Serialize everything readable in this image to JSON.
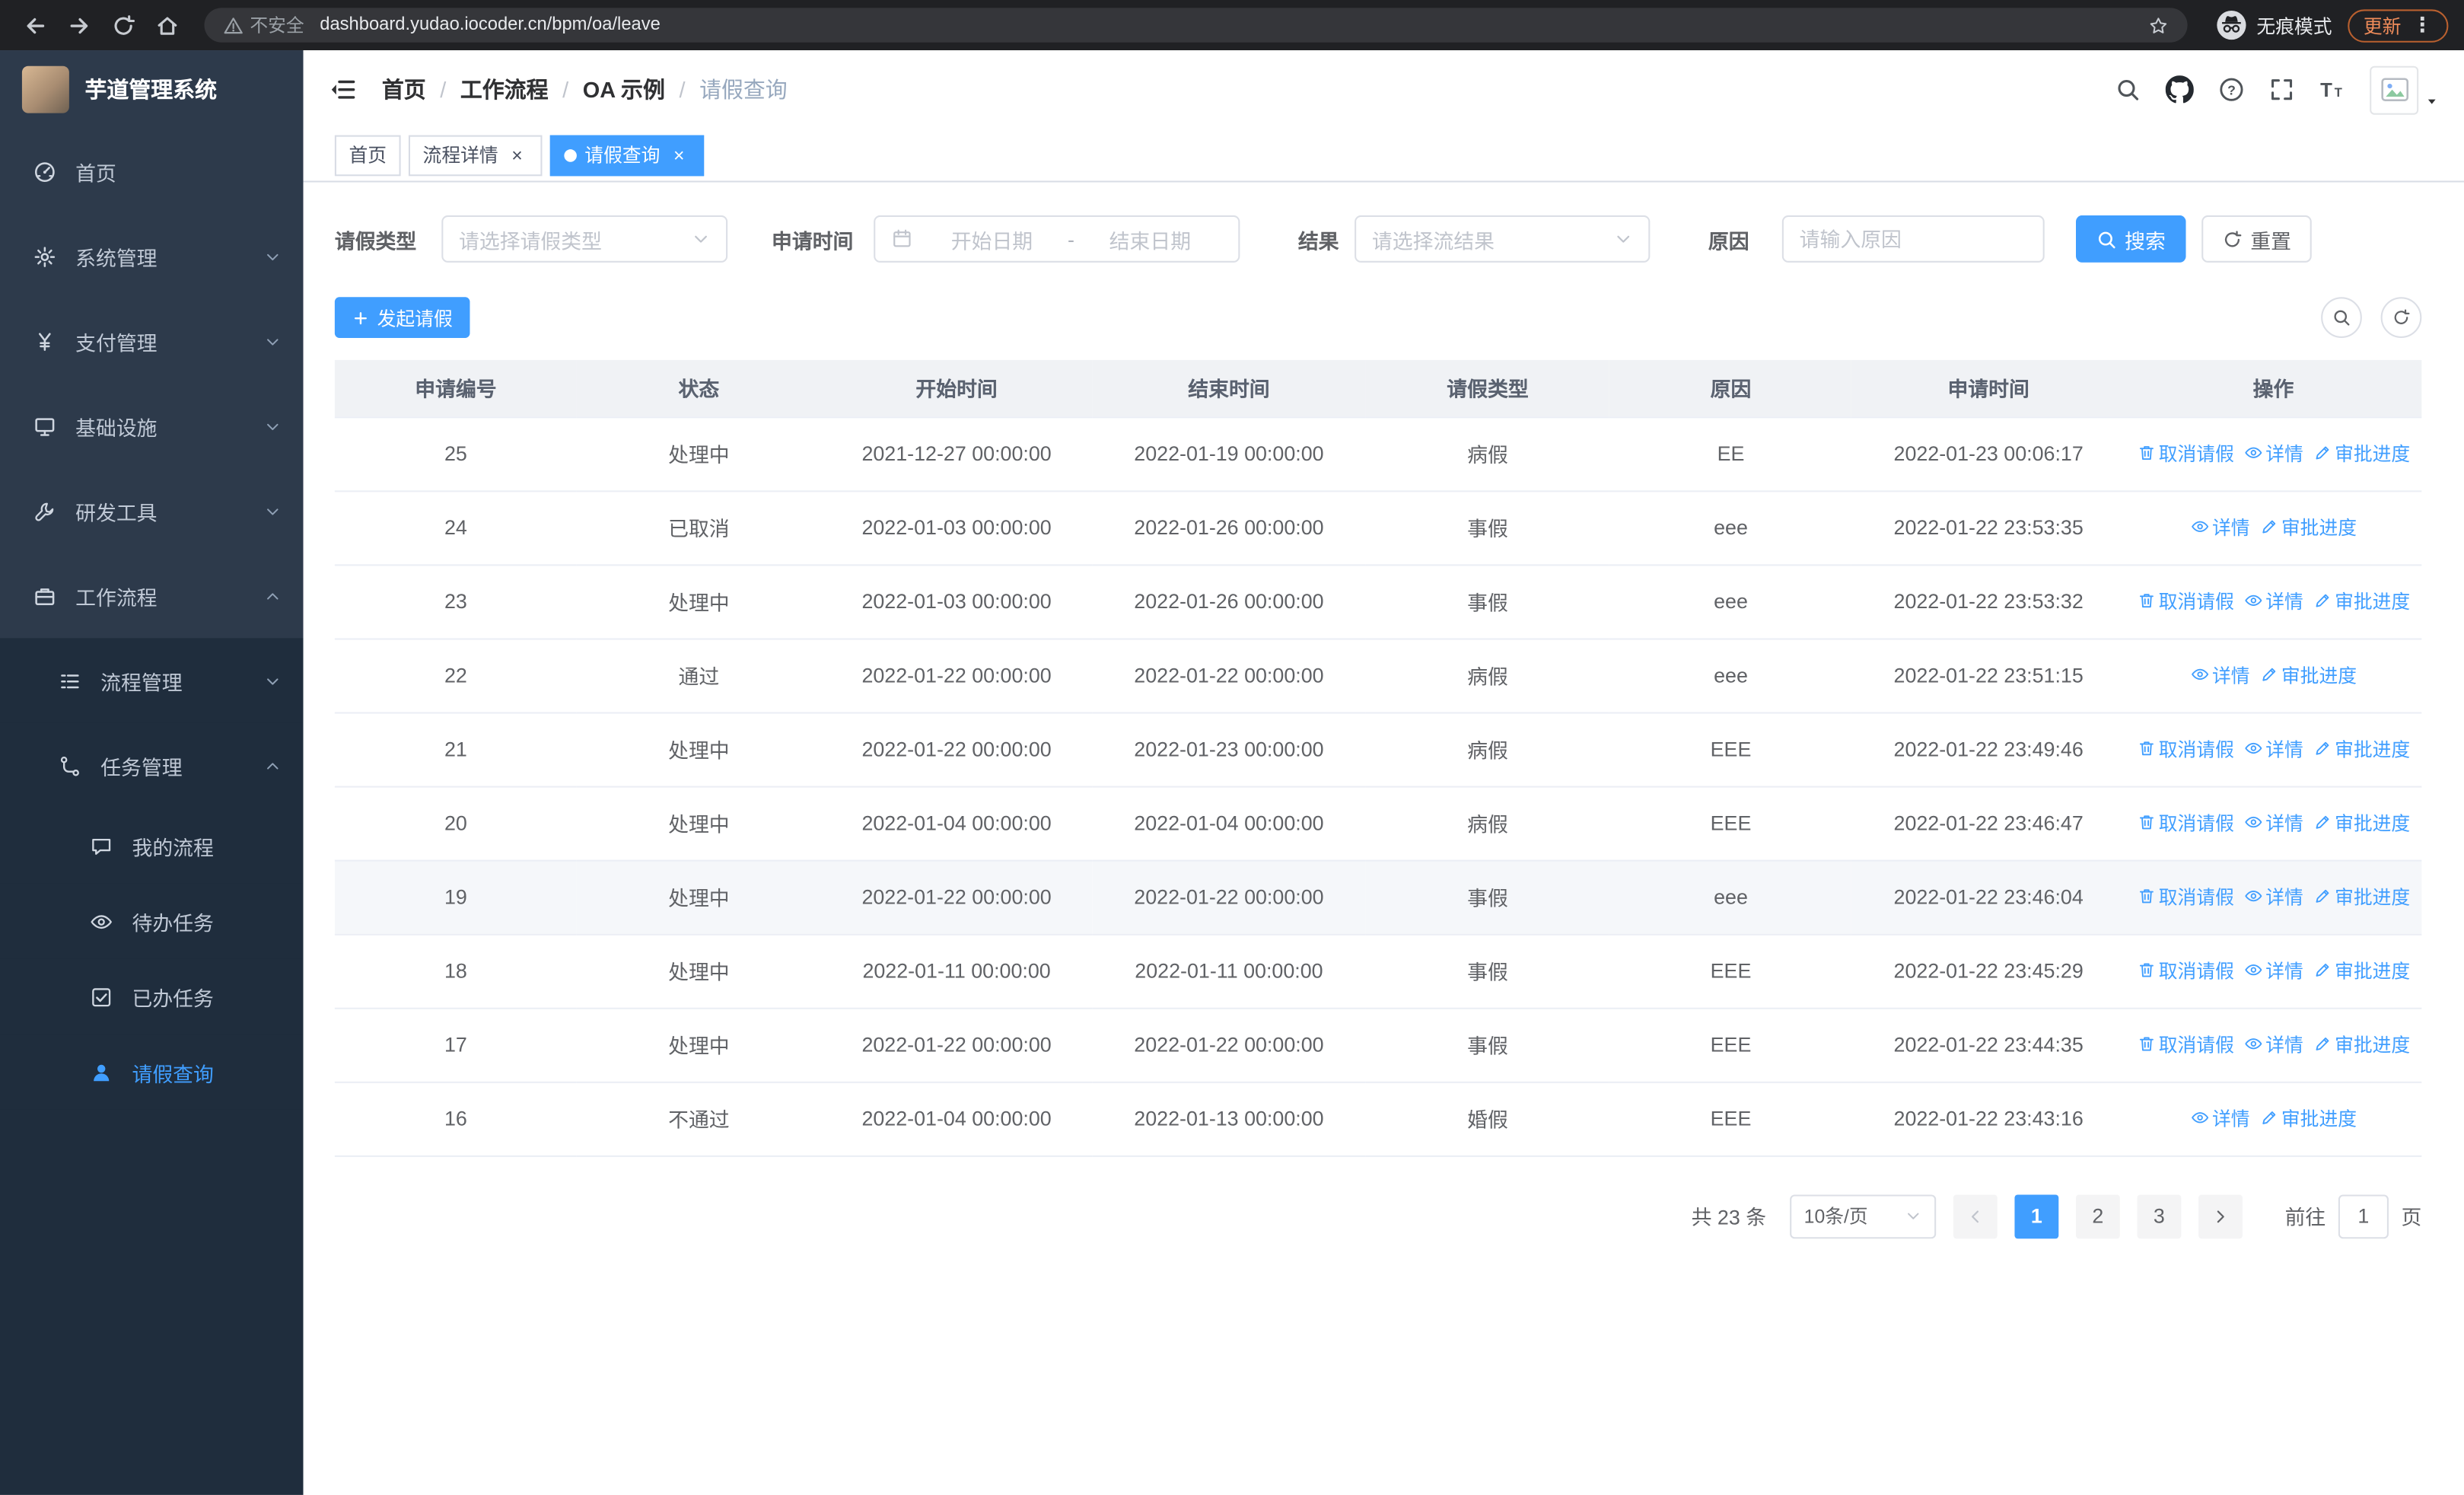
{
  "colors": {
    "accent": "#409eff",
    "sidebar_bg": "#2d3a4b",
    "submenu_bg": "#1f2d3d",
    "chrome_bg": "#202124",
    "update_orange": "#f08c5a",
    "table_border": "#ebeef5",
    "active_tab_bg": "#409eff"
  },
  "browser": {
    "security_label": "不安全",
    "url": "dashboard.yudao.iocoder.cn/bpm/oa/leave",
    "incognito_label": "无痕模式",
    "update_label": "更新"
  },
  "sidebar": {
    "logo_title": "芋道管理系统",
    "items": [
      {
        "key": "home",
        "label": "首页",
        "icon": "dashboard-icon"
      },
      {
        "key": "system",
        "label": "系统管理",
        "icon": "gear-icon",
        "chevron": "down"
      },
      {
        "key": "payment",
        "label": "支付管理",
        "icon": "yen-icon",
        "chevron": "down"
      },
      {
        "key": "infra",
        "label": "基础设施",
        "icon": "infra-icon",
        "chevron": "down"
      },
      {
        "key": "devtools",
        "label": "研发工具",
        "icon": "tools-icon",
        "chevron": "down"
      },
      {
        "key": "workflow",
        "label": "工作流程",
        "icon": "workflow-icon",
        "chevron": "up"
      }
    ],
    "sub_items": [
      {
        "key": "process-mgmt",
        "label": "流程管理",
        "icon": "process-icon",
        "chevron": "down",
        "level": 2
      },
      {
        "key": "task-mgmt",
        "label": "任务管理",
        "icon": "task-icon",
        "chevron": "up",
        "level": 2
      },
      {
        "key": "my-process",
        "label": "我的流程",
        "icon": "chat-icon",
        "level": 3
      },
      {
        "key": "todo-task",
        "label": "待办任务",
        "icon": "eye-icon",
        "level": 3
      },
      {
        "key": "done-task",
        "label": "已办任务",
        "icon": "done-icon",
        "level": 3
      },
      {
        "key": "leave-query",
        "label": "请假查询",
        "icon": "user-icon",
        "level": 3,
        "active": true
      }
    ]
  },
  "header": {
    "breadcrumb": [
      "首页",
      "工作流程",
      "OA 示例",
      "请假查询"
    ],
    "separator": "/",
    "icons": [
      "search-icon",
      "github-icon",
      "help-icon",
      "fullscreen-icon",
      "font-size-icon"
    ]
  },
  "tabs": [
    {
      "key": "home",
      "label": "首页",
      "closable": false,
      "active": false
    },
    {
      "key": "process-detail",
      "label": "流程详情",
      "closable": true,
      "active": false
    },
    {
      "key": "leave-query",
      "label": "请假查询",
      "closable": true,
      "active": true
    }
  ],
  "filters": {
    "leave_type_label": "请假类型",
    "leave_type_placeholder": "请选择请假类型",
    "apply_time_label": "申请时间",
    "start_date_placeholder": "开始日期",
    "date_separator": "-",
    "end_date_placeholder": "结束日期",
    "result_label": "结果",
    "result_placeholder": "请选择流结果",
    "reason_label": "原因",
    "reason_placeholder": "请输入原因",
    "search_label": "搜索",
    "reset_label": "重置"
  },
  "toolbar": {
    "create_label": "发起请假"
  },
  "table": {
    "columns": [
      "申请编号",
      "状态",
      "开始时间",
      "结束时间",
      "请假类型",
      "原因",
      "申请时间",
      "操作"
    ],
    "rows": [
      {
        "id": "25",
        "status": "处理中",
        "start": "2021-12-27 00:00:00",
        "end": "2022-01-19 00:00:00",
        "type": "病假",
        "reason": "EE",
        "applyTime": "2022-01-23 00:06:17",
        "actions": [
          {
            "label": "取消请假",
            "icon": "trash-icon",
            "name": "cancel-leave"
          },
          {
            "label": "详情",
            "icon": "eye-icon",
            "name": "detail"
          },
          {
            "label": "审批进度",
            "icon": "edit-icon",
            "name": "approval-progress"
          }
        ]
      },
      {
        "id": "24",
        "status": "已取消",
        "start": "2022-01-03 00:00:00",
        "end": "2022-01-26 00:00:00",
        "type": "事假",
        "reason": "eee",
        "applyTime": "2022-01-22 23:53:35",
        "actions": [
          {
            "label": "详情",
            "icon": "eye-icon",
            "name": "detail"
          },
          {
            "label": "审批进度",
            "icon": "edit-icon",
            "name": "approval-progress"
          }
        ]
      },
      {
        "id": "23",
        "status": "处理中",
        "start": "2022-01-03 00:00:00",
        "end": "2022-01-26 00:00:00",
        "type": "事假",
        "reason": "eee",
        "applyTime": "2022-01-22 23:53:32",
        "actions": [
          {
            "label": "取消请假",
            "icon": "trash-icon",
            "name": "cancel-leave"
          },
          {
            "label": "详情",
            "icon": "eye-icon",
            "name": "detail"
          },
          {
            "label": "审批进度",
            "icon": "edit-icon",
            "name": "approval-progress"
          }
        ]
      },
      {
        "id": "22",
        "status": "通过",
        "start": "2022-01-22 00:00:00",
        "end": "2022-01-22 00:00:00",
        "type": "病假",
        "reason": "eee",
        "applyTime": "2022-01-22 23:51:15",
        "actions": [
          {
            "label": "详情",
            "icon": "eye-icon",
            "name": "detail"
          },
          {
            "label": "审批进度",
            "icon": "edit-icon",
            "name": "approval-progress"
          }
        ]
      },
      {
        "id": "21",
        "status": "处理中",
        "start": "2022-01-22 00:00:00",
        "end": "2022-01-23 00:00:00",
        "type": "病假",
        "reason": "EEE",
        "applyTime": "2022-01-22 23:49:46",
        "actions": [
          {
            "label": "取消请假",
            "icon": "trash-icon",
            "name": "cancel-leave"
          },
          {
            "label": "详情",
            "icon": "eye-icon",
            "name": "detail"
          },
          {
            "label": "审批进度",
            "icon": "edit-icon",
            "name": "approval-progress"
          }
        ]
      },
      {
        "id": "20",
        "status": "处理中",
        "start": "2022-01-04 00:00:00",
        "end": "2022-01-04 00:00:00",
        "type": "病假",
        "reason": "EEE",
        "applyTime": "2022-01-22 23:46:47",
        "actions": [
          {
            "label": "取消请假",
            "icon": "trash-icon",
            "name": "cancel-leave"
          },
          {
            "label": "详情",
            "icon": "eye-icon",
            "name": "detail"
          },
          {
            "label": "审批进度",
            "icon": "edit-icon",
            "name": "approval-progress"
          }
        ]
      },
      {
        "id": "19",
        "status": "处理中",
        "start": "2022-01-22 00:00:00",
        "end": "2022-01-22 00:00:00",
        "type": "事假",
        "reason": "eee",
        "applyTime": "2022-01-22 23:46:04",
        "hover": true,
        "actions": [
          {
            "label": "取消请假",
            "icon": "trash-icon",
            "name": "cancel-leave"
          },
          {
            "label": "详情",
            "icon": "eye-icon",
            "name": "detail"
          },
          {
            "label": "审批进度",
            "icon": "edit-icon",
            "name": "approval-progress"
          }
        ]
      },
      {
        "id": "18",
        "status": "处理中",
        "start": "2022-01-11 00:00:00",
        "end": "2022-01-11 00:00:00",
        "type": "事假",
        "reason": "EEE",
        "applyTime": "2022-01-22 23:45:29",
        "actions": [
          {
            "label": "取消请假",
            "icon": "trash-icon",
            "name": "cancel-leave"
          },
          {
            "label": "详情",
            "icon": "eye-icon",
            "name": "detail"
          },
          {
            "label": "审批进度",
            "icon": "edit-icon",
            "name": "approval-progress"
          }
        ]
      },
      {
        "id": "17",
        "status": "处理中",
        "start": "2022-01-22 00:00:00",
        "end": "2022-01-22 00:00:00",
        "type": "事假",
        "reason": "EEE",
        "applyTime": "2022-01-22 23:44:35",
        "actions": [
          {
            "label": "取消请假",
            "icon": "trash-icon",
            "name": "cancel-leave"
          },
          {
            "label": "详情",
            "icon": "eye-icon",
            "name": "detail"
          },
          {
            "label": "审批进度",
            "icon": "edit-icon",
            "name": "approval-progress"
          }
        ]
      },
      {
        "id": "16",
        "status": "不通过",
        "start": "2022-01-04 00:00:00",
        "end": "2022-01-13 00:00:00",
        "type": "婚假",
        "reason": "EEE",
        "applyTime": "2022-01-22 23:43:16",
        "actions": [
          {
            "label": "详情",
            "icon": "eye-icon",
            "name": "detail"
          },
          {
            "label": "审批进度",
            "icon": "edit-icon",
            "name": "approval-progress"
          }
        ]
      }
    ]
  },
  "pagination": {
    "total_label": "共 23 条",
    "page_size_label": "10条/页",
    "pages": [
      "1",
      "2",
      "3"
    ],
    "active_page": "1",
    "goto_label": "前往",
    "goto_value": "1",
    "page_suffix": "页"
  }
}
